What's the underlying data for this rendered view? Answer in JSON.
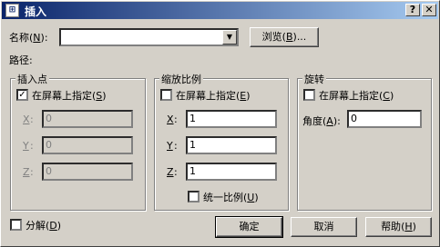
{
  "window": {
    "title": "插入",
    "help_button": "?",
    "close_button": "✕"
  },
  "name": {
    "label": "名称",
    "key": "N",
    "value": "",
    "browse_label": "浏览",
    "browse_key": "B",
    "browse_suffix": "..."
  },
  "path_label": "路径:",
  "insertion_point": {
    "title": "插入点",
    "on_screen_label": "在屏幕上指定",
    "on_screen_key": "S",
    "on_screen_checked": true,
    "x_label": "X",
    "x_value": "0",
    "y_label": "Y",
    "y_value": "0",
    "z_label": "Z",
    "z_value": "0"
  },
  "scale": {
    "title": "缩放比例",
    "on_screen_label": "在屏幕上指定",
    "on_screen_key": "E",
    "on_screen_checked": false,
    "x_label": "X",
    "x_value": "1",
    "y_label": "Y",
    "y_value": "1",
    "z_label": "Z",
    "z_value": "1",
    "uniform_label": "统一比例",
    "uniform_key": "U",
    "uniform_checked": false
  },
  "rotation": {
    "title": "旋转",
    "on_screen_label": "在屏幕上指定",
    "on_screen_key": "C",
    "on_screen_checked": false,
    "angle_label": "角度",
    "angle_key": "A",
    "angle_value": "0"
  },
  "explode": {
    "label": "分解",
    "key": "D",
    "checked": false
  },
  "buttons": {
    "ok": "确定",
    "cancel": "取消",
    "help": "帮助",
    "help_key": "H"
  },
  "colors": {
    "titlebar_start": "#0a246a",
    "titlebar_end": "#a6caf0",
    "face": "#d4d0c8"
  }
}
